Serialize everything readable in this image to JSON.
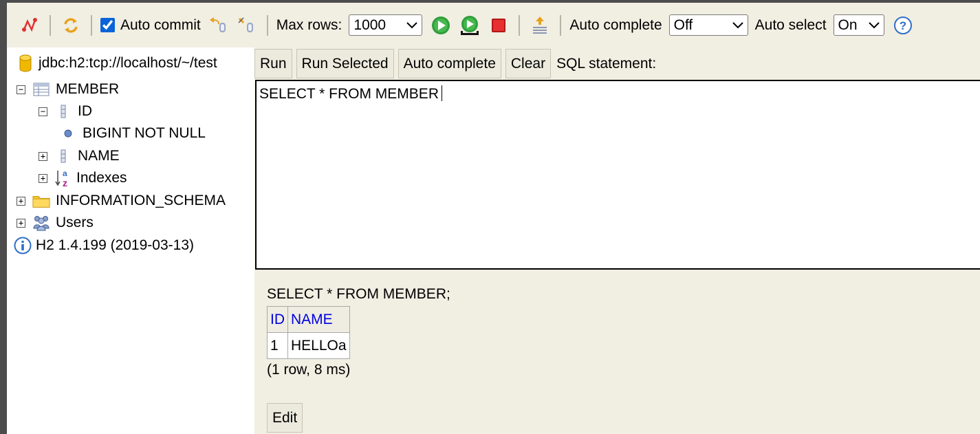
{
  "toolbar": {
    "auto_commit_label": "Auto commit",
    "auto_commit_checked": true,
    "max_rows_label": "Max rows:",
    "max_rows_value": "1000",
    "auto_complete_label": "Auto complete",
    "auto_complete_value": "Off",
    "auto_select_label": "Auto select",
    "auto_select_value": "On",
    "help_icon_char": "?"
  },
  "tree": {
    "connection": "jdbc:h2:tcp://localhost/~/test",
    "table": "MEMBER",
    "col_id": "ID",
    "col_id_type": "BIGINT NOT NULL",
    "col_name": "NAME",
    "indexes": "Indexes",
    "schema": "INFORMATION_SCHEMA",
    "users": "Users",
    "version": "H2 1.4.199 (2019-03-13)",
    "expanded_sign": "−",
    "collapsed_sign": "+"
  },
  "buttons": {
    "run": "Run",
    "run_selected": "Run Selected",
    "auto_complete": "Auto complete",
    "clear": "Clear",
    "sql_label": "SQL statement:"
  },
  "editor": {
    "text": "SELECT * FROM MEMBER"
  },
  "result": {
    "statement": "SELECT * FROM MEMBER;",
    "columns": [
      "ID",
      "NAME"
    ],
    "rows": [
      [
        "1",
        "HELLOa"
      ]
    ],
    "meta": "(1 row, 8 ms)",
    "edit_label": "Edit"
  },
  "colors": {
    "panel_bg": "#f1eee2",
    "header_link": "#0000e0",
    "run_green": "#2e9e3a",
    "stop_red": "#e02020"
  }
}
